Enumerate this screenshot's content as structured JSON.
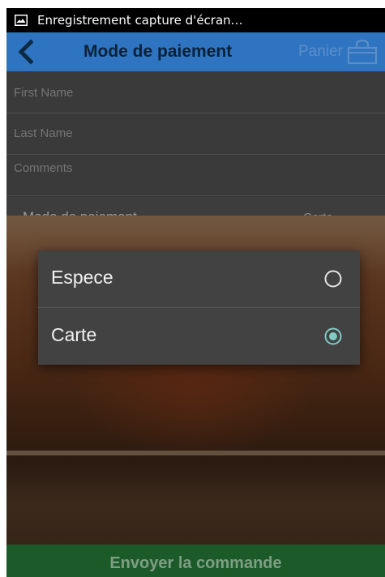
{
  "status_bar": {
    "notification_text": "Enregistrement capture d'écran…",
    "icon": "screenshot-icon"
  },
  "app_bar": {
    "back_icon": "chevron-left-icon",
    "title": "Mode de paiement",
    "cart_label": "Panier",
    "cart_icon": "shopping-bag-icon",
    "color": "#2f74c0"
  },
  "form": {
    "first_name_placeholder": "First Name",
    "last_name_placeholder": "Last Name",
    "comments_placeholder": "Comments",
    "payment_label": "Mode de paiement",
    "payment_selected": "Carte"
  },
  "dialog": {
    "options": [
      {
        "label": "Espece",
        "selected": false
      },
      {
        "label": "Carte",
        "selected": true
      }
    ],
    "accent_color": "#80cbc4"
  },
  "footer": {
    "submit_label": "Envoyer la commande",
    "color": "#1d5a2a"
  }
}
